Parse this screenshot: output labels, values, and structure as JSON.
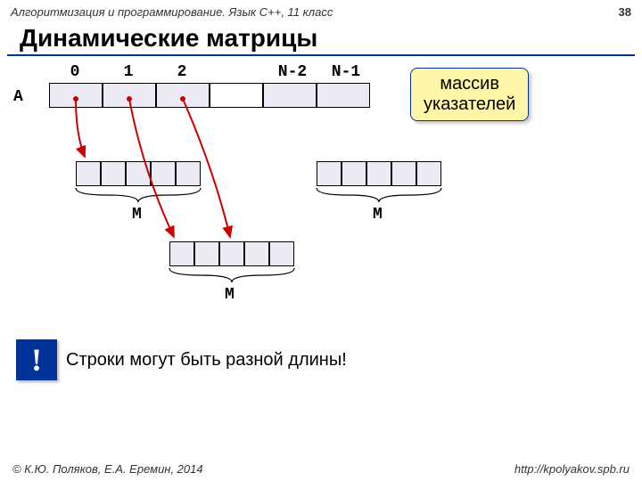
{
  "header": {
    "left": "Алгоритмизация и программирование. Язык C++, 11 класс",
    "right": "38"
  },
  "title": "Динамические матрицы",
  "array": {
    "label": "A",
    "indices": [
      "0",
      "1",
      "2",
      "N-2",
      "N-1"
    ]
  },
  "callout": {
    "line1": "массив",
    "line2": "указателей"
  },
  "mLabels": {
    "m1": "M",
    "m2": "M",
    "m3": "M"
  },
  "warning": {
    "icon": "!",
    "text": "Строки могут быть разной длины!"
  },
  "footer": {
    "left": "© К.Ю. Поляков, Е.А. Еремин, 2014",
    "right": "http://kpolyakov.spb.ru"
  }
}
